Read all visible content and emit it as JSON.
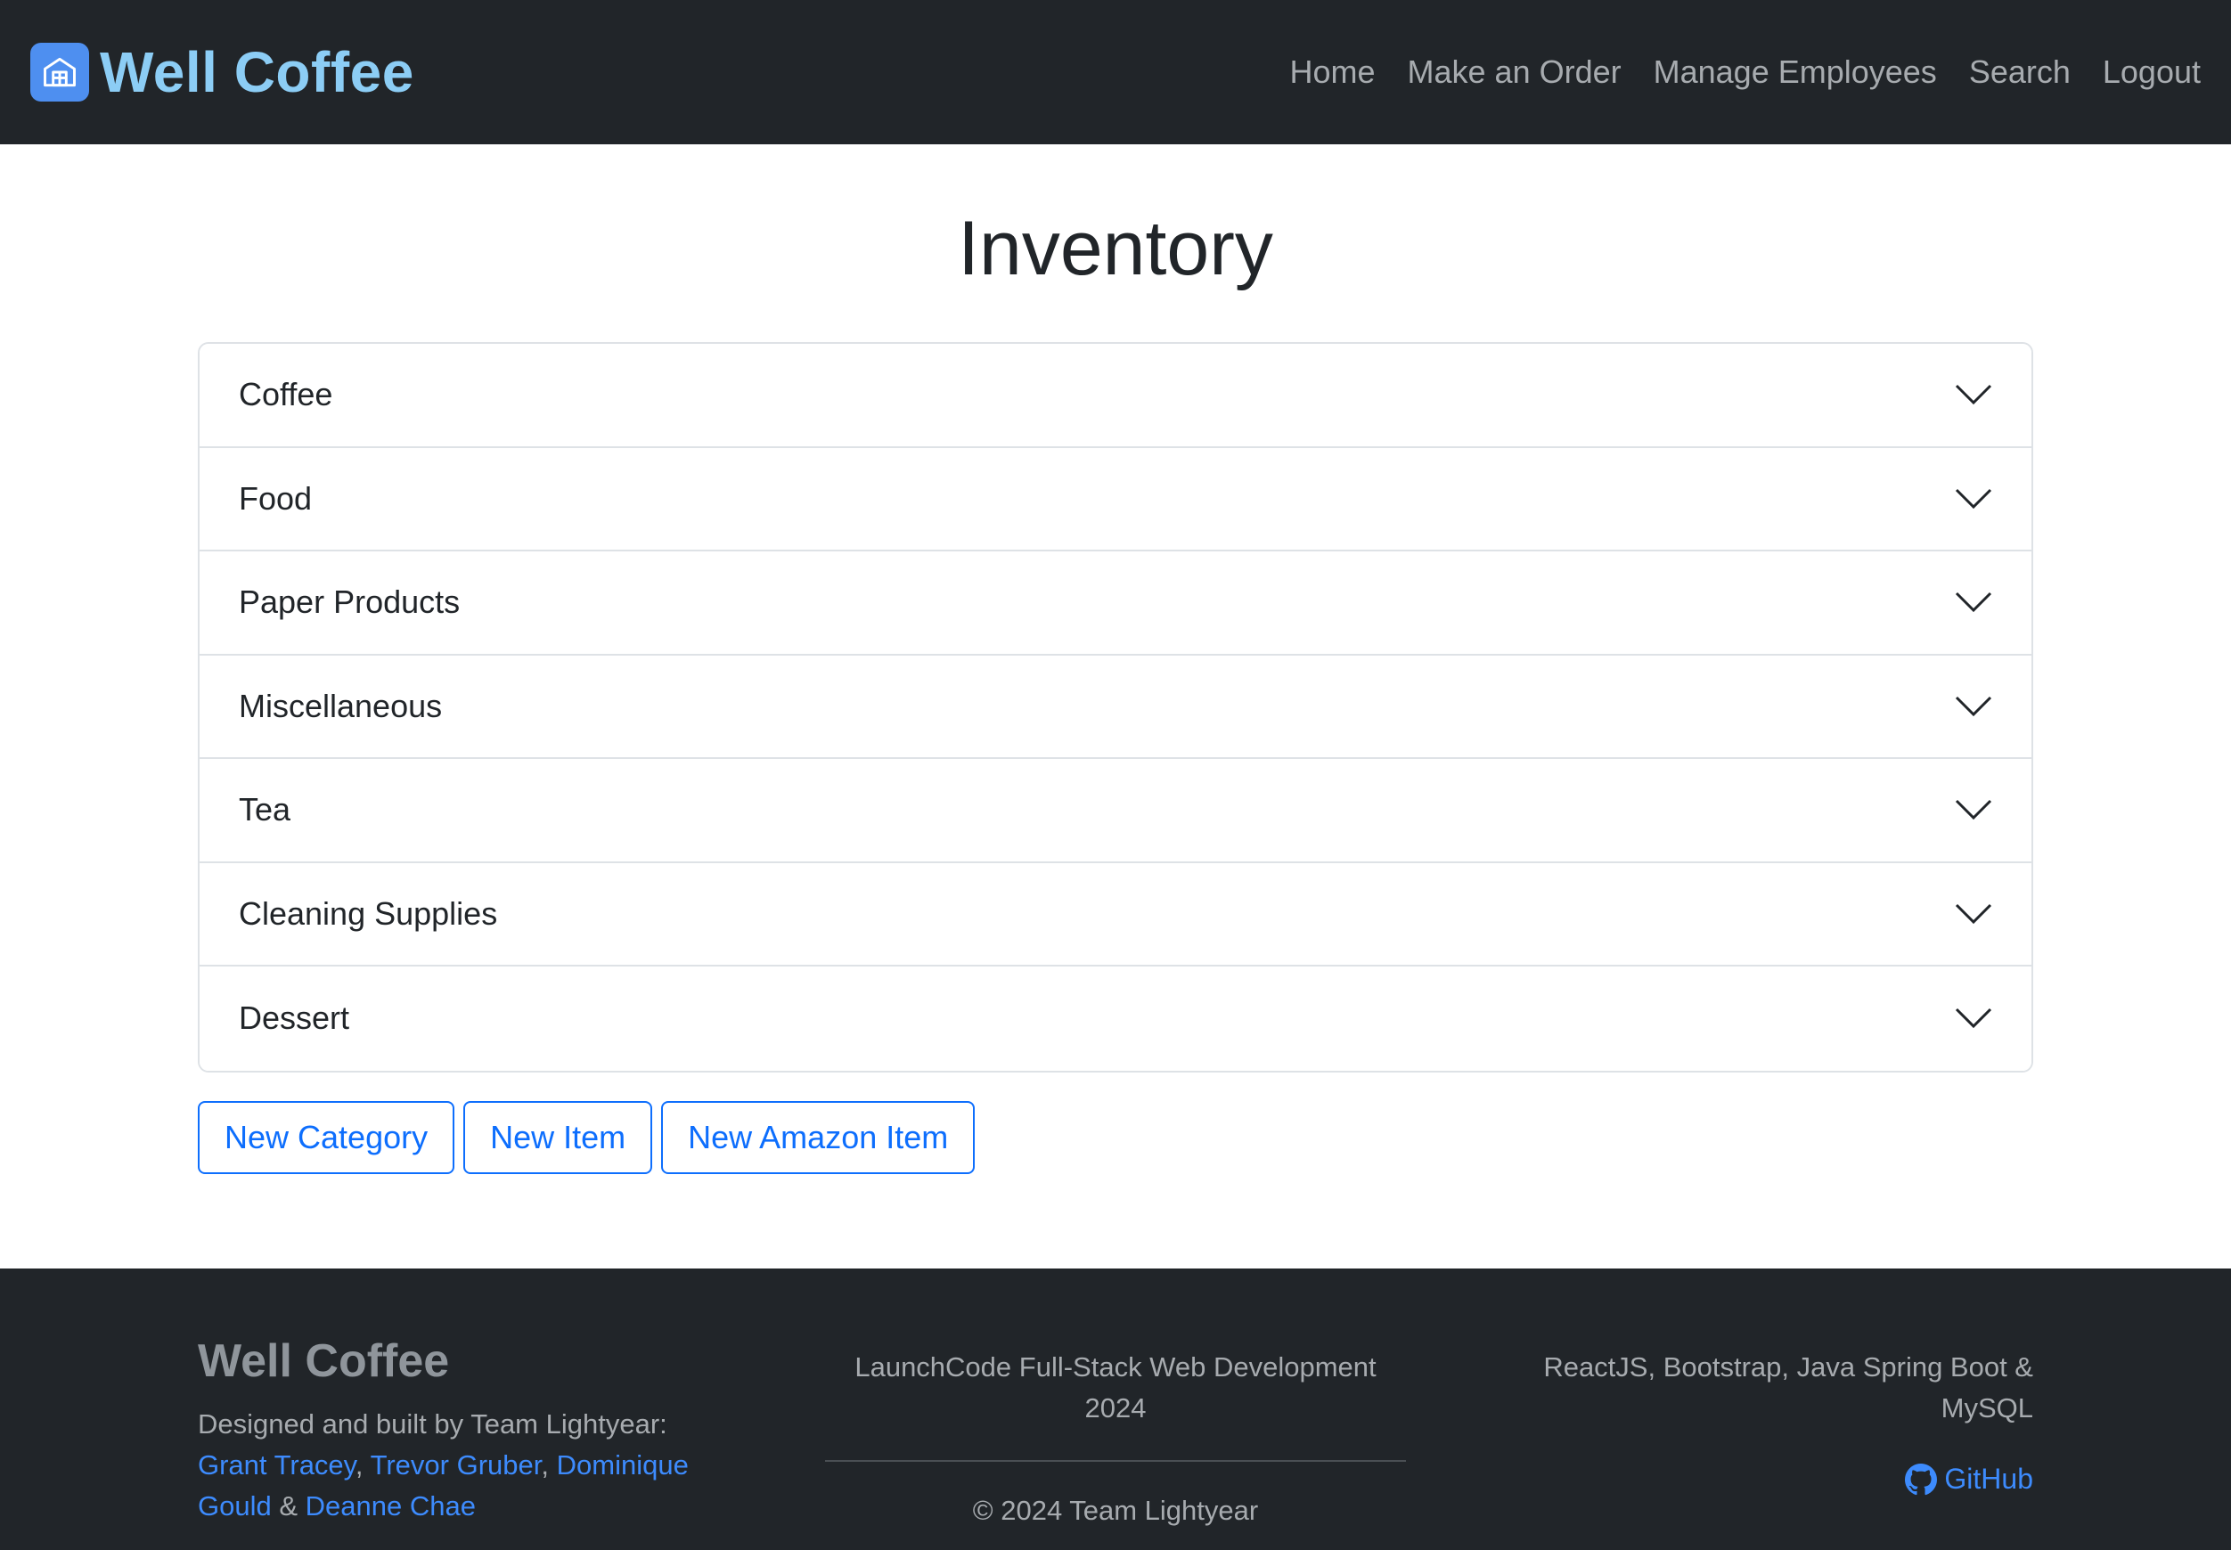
{
  "navbar": {
    "brand": "Well Coffee",
    "brand_icon": "building-icon",
    "links": [
      "Home",
      "Make an Order",
      "Manage Employees",
      "Search",
      "Logout"
    ]
  },
  "main": {
    "title": "Inventory",
    "categories": [
      "Coffee",
      "Food",
      "Paper Products",
      "Miscellaneous",
      "Tea",
      "Cleaning Supplies",
      "Dessert"
    ],
    "buttons": {
      "new_category": "New Category",
      "new_item": "New Item",
      "new_amazon_item": "New Amazon Item"
    }
  },
  "footer": {
    "brand": "Well Coffee",
    "credits_intro": "Designed and built by Team Lightyear:",
    "members": [
      "Grant Tracey",
      "Trevor Gruber",
      "Dominique Gould",
      "Deanne Chae"
    ],
    "sep_comma": ",",
    "sep_and": "&",
    "program": "LaunchCode Full-Stack Web Development 2024",
    "copyright": "© 2024 Team Lightyear",
    "stack": "ReactJS, Bootstrap, Java Spring Boot & MySQL",
    "github_label": "GitHub",
    "github_icon": "github-icon"
  },
  "colors": {
    "nav_bg": "#212529",
    "brand_text": "#8ccdf5",
    "brand_icon_bg": "#4e8ff0",
    "primary": "#0d6efd",
    "link": "#3d8bfd"
  }
}
